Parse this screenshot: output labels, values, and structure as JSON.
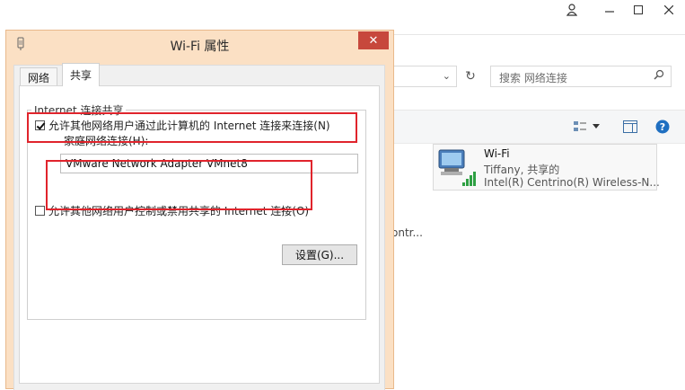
{
  "background_window": {
    "search_placeholder": "搜索 网络连接",
    "truncated_text": "ontr...",
    "connection": {
      "name": "Wi-Fi",
      "status": "Tiffany, 共享的",
      "adapter": "Intel(R) Centrino(R) Wireless-N..."
    },
    "icons": [
      "user-icon",
      "minimize-icon",
      "maximize-icon",
      "close-icon",
      "chevron-down-icon",
      "refresh-icon",
      "search-icon",
      "change-view-icon",
      "dropdown-arrow-icon",
      "preview-pane-icon",
      "help-icon",
      "network-adapter-icon",
      "signal-bars-icon"
    ]
  },
  "dialog": {
    "title": "Wi-Fi 属性",
    "tabs": [
      {
        "label": "网络",
        "active": false
      },
      {
        "label": "共享",
        "active": true
      }
    ],
    "group_title": "Internet 连接共享",
    "allow_share_label": "允许其他网络用户通过此计算机的 Internet 连接来连接(N)",
    "allow_share_checked": true,
    "home_network_label": "家庭网络连接(H):",
    "home_network_value": "VMware Network Adapter VMnet8",
    "allow_control_label": "允许其他网络用户控制或禁用共享的 Internet 连接(O)",
    "allow_control_checked": false,
    "settings_button": "设置(G)..."
  },
  "annotation_color": "#e0242c",
  "colors": {
    "dialog_frame": "#fbe0c4",
    "close_button": "#c7483c"
  }
}
